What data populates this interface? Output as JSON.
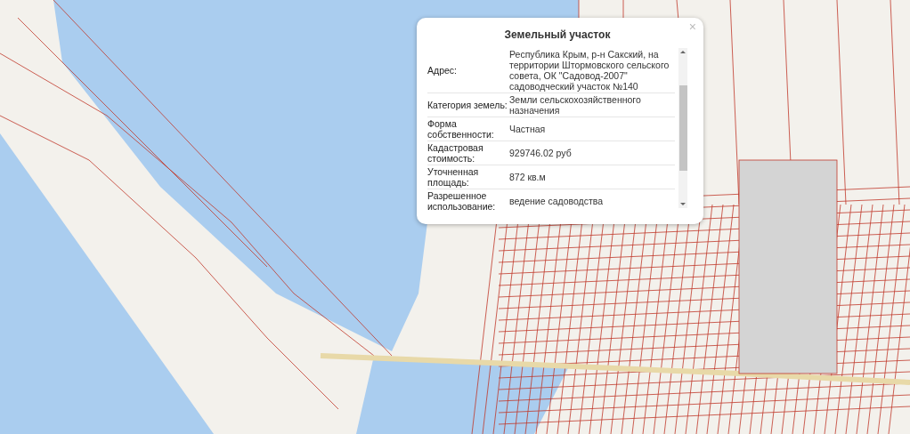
{
  "popup": {
    "title": "Земельный участок",
    "close": "×",
    "rows": [
      {
        "label": "Адрес:",
        "value": "Республика Крым, р-н Сакский, на территории Штормовского сельского совета, ОК \"Садовод-2007\" садоводческий участок №140"
      },
      {
        "label": "Категория земель:",
        "value": "Земли сельскохозяйственного назначения"
      },
      {
        "label": "Форма собственности:",
        "value": "Частная"
      },
      {
        "label": "Кадастровая стоимость:",
        "value": "929746.02 руб"
      },
      {
        "label": "Уточненная площадь:",
        "value": "872 кв.м"
      },
      {
        "label": "Разрешенное использование:",
        "value": "ведение садоводства"
      }
    ]
  }
}
